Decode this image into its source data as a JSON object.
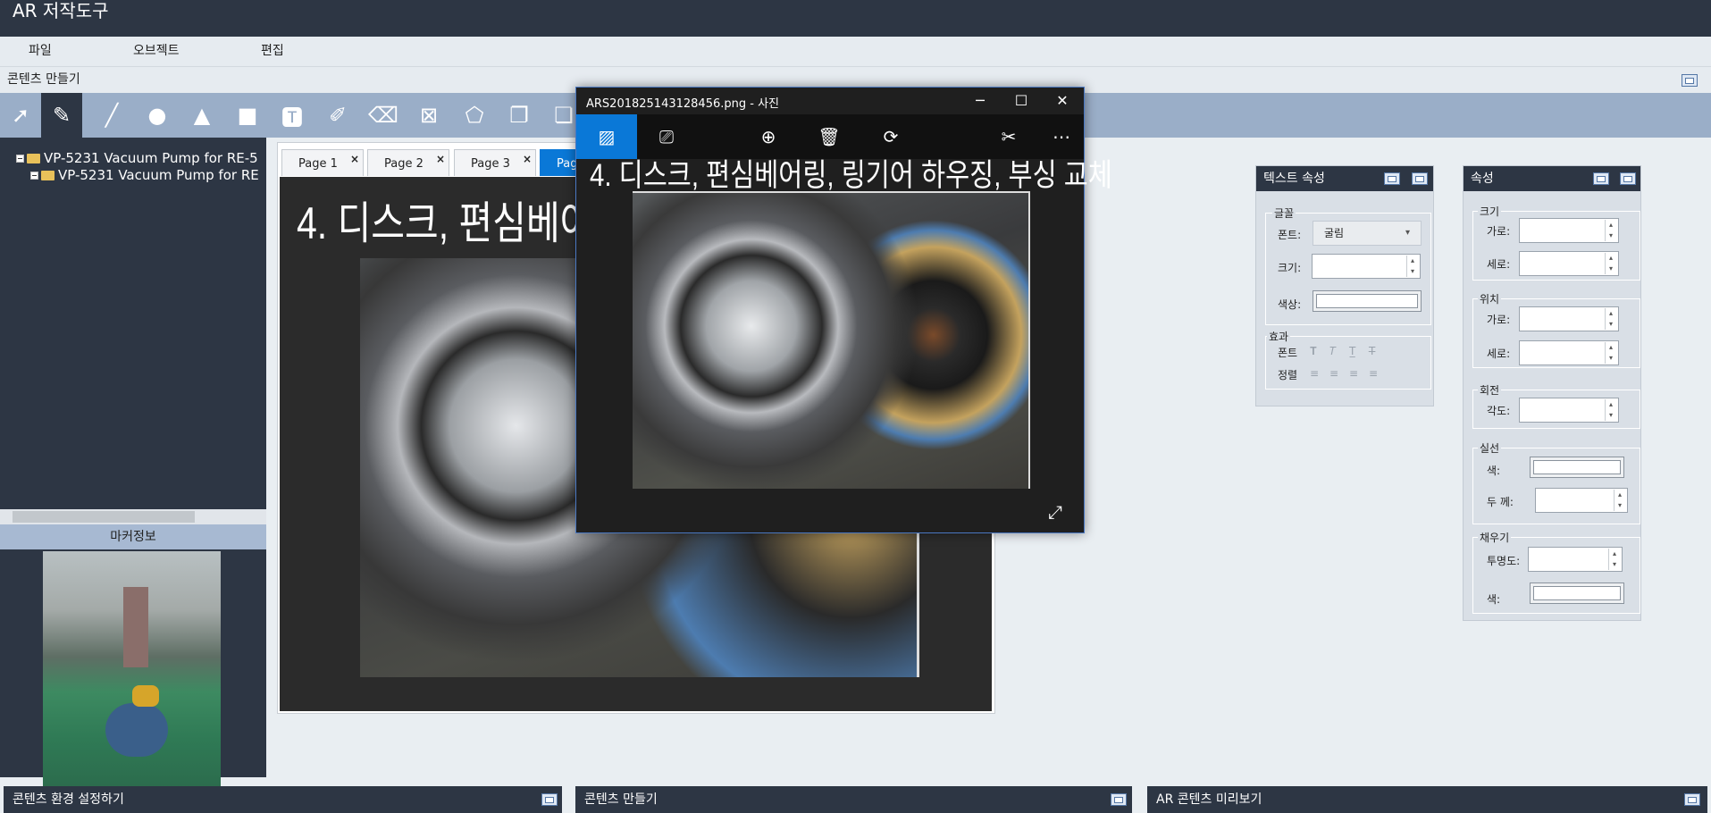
{
  "app": {
    "title": "AR 저작도구"
  },
  "menu": [
    "파일",
    "오브젝트",
    "편집"
  ],
  "content_title": "콘텐츠 만들기",
  "tree": {
    "items": [
      {
        "label": "VP-5231 Vacuum Pump for RE-5"
      },
      {
        "label": "VP-5231 Vacuum Pump for RE"
      }
    ]
  },
  "marker": {
    "title": "마커정보"
  },
  "tabs": [
    {
      "label": "Page 1"
    },
    {
      "label": "Page 2"
    },
    {
      "label": "Page 3"
    },
    {
      "label": "Page"
    }
  ],
  "tab_close": "×",
  "slide": {
    "title": "4. 디스크, 편심베어링"
  },
  "photo_viewer": {
    "title": "ARS201825143128456.png - 사진",
    "headline": "4. 디스크, 편심베어링, 링기어 하우징, 부싱 교체"
  },
  "text_props": {
    "title": "텍스트 속성",
    "font_group": "글꼴",
    "font_label": "폰트:",
    "font_value": "굴림",
    "size_label": "크기:",
    "color_label": "색상:",
    "effect_group": "효과",
    "effect_font_label": "폰트",
    "effect_align_label": "정렬"
  },
  "props": {
    "title": "속성",
    "size_group": "크기",
    "width_label": "가로:",
    "height_label": "세로:",
    "pos_group": "위치",
    "pos_x_label": "가로:",
    "pos_y_label": "세로:",
    "rot_group": "회전",
    "angle_label": "각도:",
    "line_group": "실선",
    "line_color_label": "색:",
    "line_thickness_label": "두     께:",
    "fill_group": "채우기",
    "opacity_label": "투명도:",
    "fill_color_label": "색:"
  },
  "bottom": {
    "left": "콘텐츠 환경 설정하기",
    "center": "콘텐츠 만들기",
    "right": "AR 콘텐츠 미리보기"
  },
  "colors": {
    "dark_bar": "#2d3644",
    "toolbar": "#9aaec8",
    "accent_blue": "#0a78d7"
  }
}
